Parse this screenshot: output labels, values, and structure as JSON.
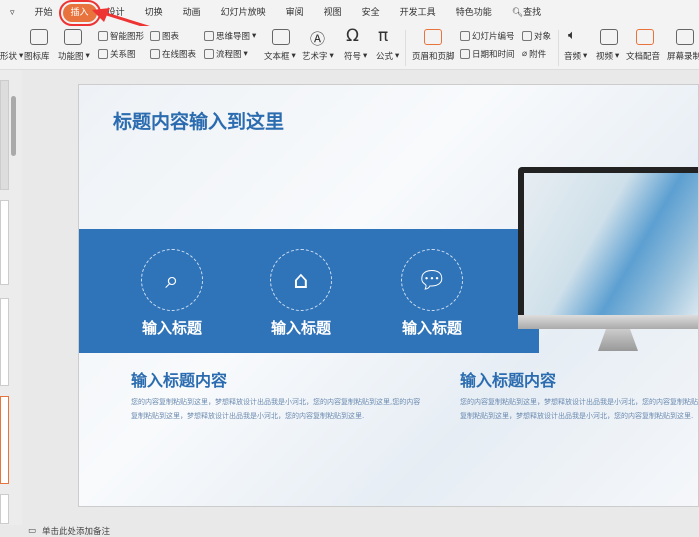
{
  "menubar": {
    "tabs": [
      "开始",
      "插入",
      "设计",
      "切换",
      "动画",
      "幻灯片放映",
      "审阅",
      "视图",
      "安全",
      "开发工具",
      "特色功能"
    ],
    "active": "插入",
    "search": "查找"
  },
  "ribbon": {
    "items": {
      "shape": "形状",
      "icon_lib": "图标库",
      "func_chart": "功能图",
      "smart": "智能图形",
      "chart": "图表",
      "mindmap": "思维导图",
      "relation": "关系图",
      "online_chart": "在线图表",
      "flow": "流程图",
      "textbox": "文本框",
      "wordart": "艺术字",
      "symbol": "符号",
      "formula": "公式",
      "header_footer": "页眉和页脚",
      "slide_no": "幻灯片编号",
      "object": "对象",
      "datetime": "日期和时间",
      "attach": "附件",
      "audio": "音频",
      "video": "视频",
      "dub": "文档配音",
      "record": "屏幕录制"
    }
  },
  "slide": {
    "title": "标题内容输入到这里",
    "features": [
      {
        "label": "输入标题",
        "icon": "search-icon"
      },
      {
        "label": "输入标题",
        "icon": "home-icon"
      },
      {
        "label": "输入标题",
        "icon": "chat-icon"
      }
    ],
    "columns": [
      {
        "heading": "输入标题内容",
        "body": "您的内容复制粘贴到这里，梦想释放设计出品我是小河北，您的内容复制粘贴到这里,您的内容复制粘贴到这里，梦想释放设计出品我是小河北，您的内容复制粘贴到这里."
      },
      {
        "heading": "输入标题内容",
        "body": "您的内容复制粘贴到这里，梦想释放设计出品我是小河北，您的内容复制粘贴到这里,您的内容复制粘贴到这里，梦想释放设计出品我是小河北，您的内容复制粘贴到这里."
      }
    ]
  },
  "notes": {
    "placeholder": "单击此处添加备注"
  },
  "colors": {
    "accent": "#e8733c",
    "band": "#2f73b9",
    "title": "#2b6cb0"
  }
}
